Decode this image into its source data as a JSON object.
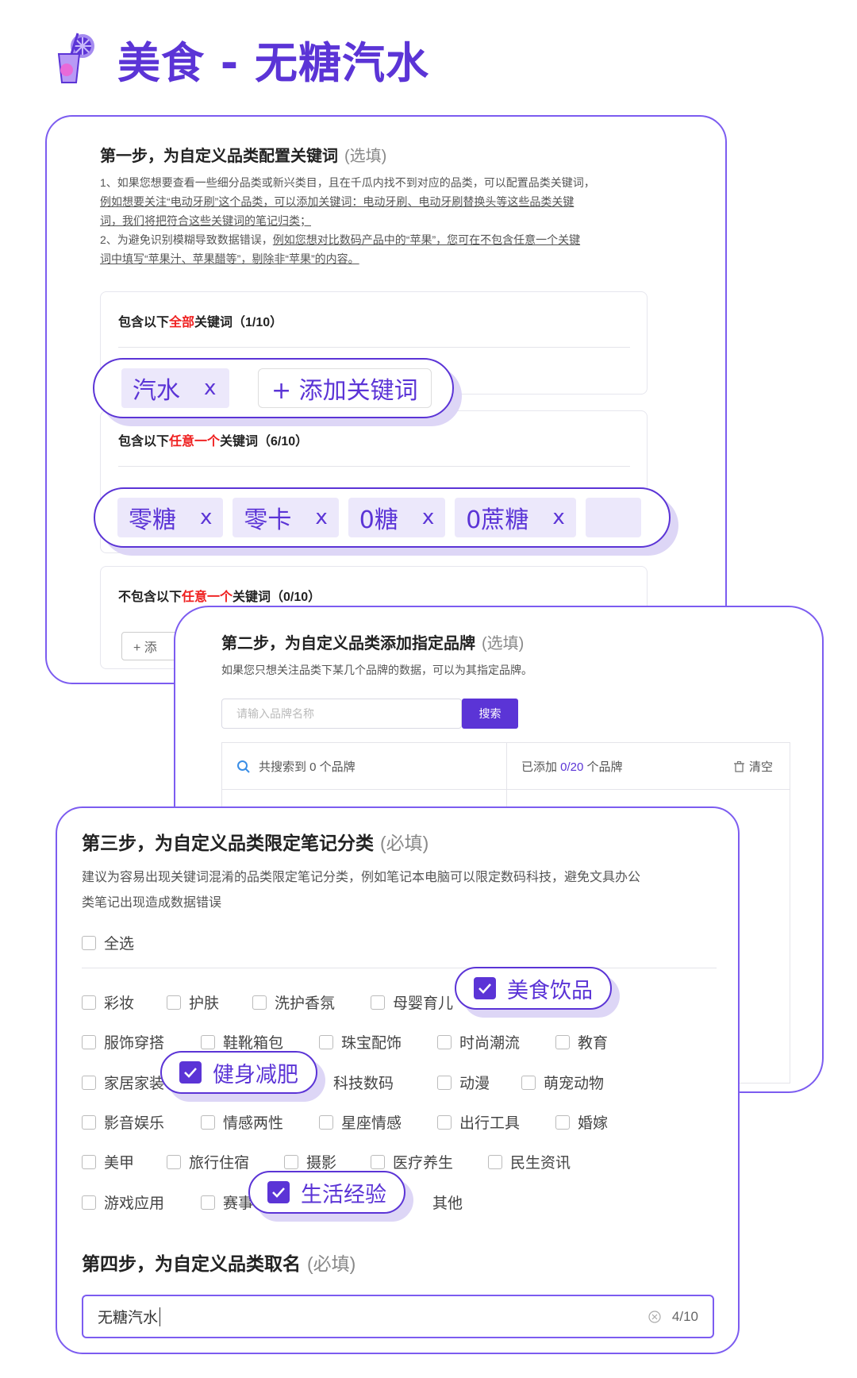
{
  "header": {
    "title": "美食 - 无糖汽水"
  },
  "step1": {
    "title": "第一步，为自定义品类配置关键词",
    "hint": "(选填)",
    "desc1": "1、如果您想要查看一些细分品类或新兴类目，且在千瓜内找不到对应的品类，可以配置品类关键词，",
    "desc1b": "例如想要关注“电动牙刷”这个品类，可以添加关键词：电动牙刷、电动牙刷替换头等这些品类关键",
    "desc1c": "词，我们将把符合这些关键词的笔记归类；",
    "desc2a": "2、为避免识别模糊导致数据错误，",
    "desc2b": "例如您想对比数码产品中的“苹果”，您可在不包含任意一个关键",
    "desc2c": "词中填写“苹果汁、苹果醋等”，剔除非“苹果”的内容。",
    "group_all": {
      "prefix": "包含以下",
      "highlight": "全部",
      "suffix": "关键词（1/10）"
    },
    "group_any": {
      "prefix": "包含以下",
      "highlight": "任意一个",
      "suffix": "关键词（6/10）"
    },
    "group_none": {
      "prefix": "不包含以下",
      "highlight": "任意一个",
      "suffix": "关键词（0/10）"
    },
    "add_small": "+ 添",
    "all_tags": [
      {
        "label": "汽水",
        "x": "x"
      }
    ],
    "add_keyword": "+ 添加关键词",
    "any_tags": [
      {
        "label": "零糖",
        "x": "x"
      },
      {
        "label": "零卡",
        "x": "x"
      },
      {
        "label": "0糖",
        "x": "x"
      },
      {
        "label": "0蔗糖",
        "x": "x"
      }
    ]
  },
  "step2": {
    "title": "第二步，为自定义品类添加指定品牌",
    "hint": "(选填)",
    "desc": "如果您只想关注品类下某几个品牌的数据，可以为其指定品牌。",
    "search_placeholder": "请输入品牌名称",
    "search_button": "搜索",
    "found": "共搜索到 0 个品牌",
    "added_prefix": "已添加 ",
    "added_count": "0/20",
    "added_suffix": " 个品牌",
    "clear": "清空"
  },
  "step3": {
    "title": "第三步，为自定义品类限定笔记分类",
    "hint": "(必填)",
    "desc1": "建议为容易出现关键词混淆的品类限定笔记分类，例如笔记本电脑可以限定数码科技，避免文具办公",
    "desc2": "类笔记出现造成数据错误",
    "select_all": "全选",
    "categories": [
      "彩妆",
      "护肤",
      "洗护香氛",
      "母婴育儿",
      "美食饮品",
      "服饰穿搭",
      "鞋靴箱包",
      "珠宝配饰",
      "时尚潮流",
      "教育",
      "家居家装",
      "健身减肥",
      "科技数码",
      "动漫",
      "萌宠动物",
      "影音娱乐",
      "情感两性",
      "星座情感",
      "出行工具",
      "婚嫁",
      "美甲",
      "旅行住宿",
      "摄影",
      "医疗养生",
      "民生资讯",
      "游戏应用",
      "赛事",
      "生活经验",
      "其他"
    ],
    "checked": [
      "美食饮品",
      "健身减肥",
      "生活经验"
    ]
  },
  "step4": {
    "title": "第四步，为自定义品类取名",
    "hint": "(必填)",
    "value": "无糖汽水",
    "counter": "4/10"
  },
  "colors": {
    "accent": "#5b34d6",
    "highlight": "#ef1f1f",
    "shadow": "#ddd6f6"
  }
}
